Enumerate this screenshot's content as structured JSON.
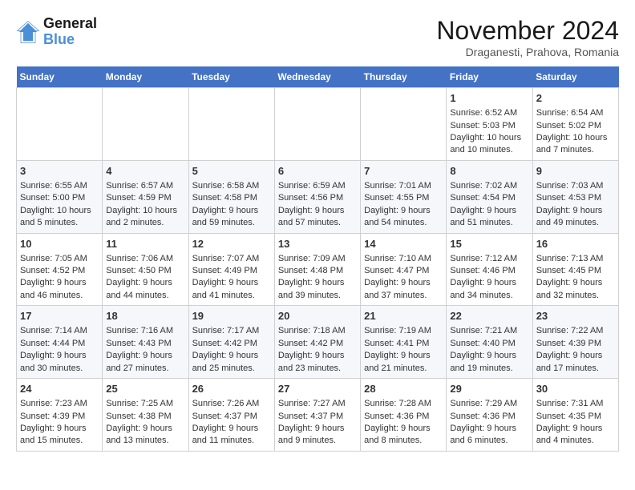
{
  "logo": {
    "line1": "General",
    "line2": "Blue"
  },
  "title": "November 2024",
  "subtitle": "Draganesti, Prahova, Romania",
  "headers": [
    "Sunday",
    "Monday",
    "Tuesday",
    "Wednesday",
    "Thursday",
    "Friday",
    "Saturday"
  ],
  "weeks": [
    [
      {
        "day": "",
        "lines": []
      },
      {
        "day": "",
        "lines": []
      },
      {
        "day": "",
        "lines": []
      },
      {
        "day": "",
        "lines": []
      },
      {
        "day": "",
        "lines": []
      },
      {
        "day": "1",
        "lines": [
          "Sunrise: 6:52 AM",
          "Sunset: 5:03 PM",
          "Daylight: 10 hours and 10 minutes."
        ]
      },
      {
        "day": "2",
        "lines": [
          "Sunrise: 6:54 AM",
          "Sunset: 5:02 PM",
          "Daylight: 10 hours and 7 minutes."
        ]
      }
    ],
    [
      {
        "day": "3",
        "lines": [
          "Sunrise: 6:55 AM",
          "Sunset: 5:00 PM",
          "Daylight: 10 hours and 5 minutes."
        ]
      },
      {
        "day": "4",
        "lines": [
          "Sunrise: 6:57 AM",
          "Sunset: 4:59 PM",
          "Daylight: 10 hours and 2 minutes."
        ]
      },
      {
        "day": "5",
        "lines": [
          "Sunrise: 6:58 AM",
          "Sunset: 4:58 PM",
          "Daylight: 9 hours and 59 minutes."
        ]
      },
      {
        "day": "6",
        "lines": [
          "Sunrise: 6:59 AM",
          "Sunset: 4:56 PM",
          "Daylight: 9 hours and 57 minutes."
        ]
      },
      {
        "day": "7",
        "lines": [
          "Sunrise: 7:01 AM",
          "Sunset: 4:55 PM",
          "Daylight: 9 hours and 54 minutes."
        ]
      },
      {
        "day": "8",
        "lines": [
          "Sunrise: 7:02 AM",
          "Sunset: 4:54 PM",
          "Daylight: 9 hours and 51 minutes."
        ]
      },
      {
        "day": "9",
        "lines": [
          "Sunrise: 7:03 AM",
          "Sunset: 4:53 PM",
          "Daylight: 9 hours and 49 minutes."
        ]
      }
    ],
    [
      {
        "day": "10",
        "lines": [
          "Sunrise: 7:05 AM",
          "Sunset: 4:52 PM",
          "Daylight: 9 hours and 46 minutes."
        ]
      },
      {
        "day": "11",
        "lines": [
          "Sunrise: 7:06 AM",
          "Sunset: 4:50 PM",
          "Daylight: 9 hours and 44 minutes."
        ]
      },
      {
        "day": "12",
        "lines": [
          "Sunrise: 7:07 AM",
          "Sunset: 4:49 PM",
          "Daylight: 9 hours and 41 minutes."
        ]
      },
      {
        "day": "13",
        "lines": [
          "Sunrise: 7:09 AM",
          "Sunset: 4:48 PM",
          "Daylight: 9 hours and 39 minutes."
        ]
      },
      {
        "day": "14",
        "lines": [
          "Sunrise: 7:10 AM",
          "Sunset: 4:47 PM",
          "Daylight: 9 hours and 37 minutes."
        ]
      },
      {
        "day": "15",
        "lines": [
          "Sunrise: 7:12 AM",
          "Sunset: 4:46 PM",
          "Daylight: 9 hours and 34 minutes."
        ]
      },
      {
        "day": "16",
        "lines": [
          "Sunrise: 7:13 AM",
          "Sunset: 4:45 PM",
          "Daylight: 9 hours and 32 minutes."
        ]
      }
    ],
    [
      {
        "day": "17",
        "lines": [
          "Sunrise: 7:14 AM",
          "Sunset: 4:44 PM",
          "Daylight: 9 hours and 30 minutes."
        ]
      },
      {
        "day": "18",
        "lines": [
          "Sunrise: 7:16 AM",
          "Sunset: 4:43 PM",
          "Daylight: 9 hours and 27 minutes."
        ]
      },
      {
        "day": "19",
        "lines": [
          "Sunrise: 7:17 AM",
          "Sunset: 4:42 PM",
          "Daylight: 9 hours and 25 minutes."
        ]
      },
      {
        "day": "20",
        "lines": [
          "Sunrise: 7:18 AM",
          "Sunset: 4:42 PM",
          "Daylight: 9 hours and 23 minutes."
        ]
      },
      {
        "day": "21",
        "lines": [
          "Sunrise: 7:19 AM",
          "Sunset: 4:41 PM",
          "Daylight: 9 hours and 21 minutes."
        ]
      },
      {
        "day": "22",
        "lines": [
          "Sunrise: 7:21 AM",
          "Sunset: 4:40 PM",
          "Daylight: 9 hours and 19 minutes."
        ]
      },
      {
        "day": "23",
        "lines": [
          "Sunrise: 7:22 AM",
          "Sunset: 4:39 PM",
          "Daylight: 9 hours and 17 minutes."
        ]
      }
    ],
    [
      {
        "day": "24",
        "lines": [
          "Sunrise: 7:23 AM",
          "Sunset: 4:39 PM",
          "Daylight: 9 hours and 15 minutes."
        ]
      },
      {
        "day": "25",
        "lines": [
          "Sunrise: 7:25 AM",
          "Sunset: 4:38 PM",
          "Daylight: 9 hours and 13 minutes."
        ]
      },
      {
        "day": "26",
        "lines": [
          "Sunrise: 7:26 AM",
          "Sunset: 4:37 PM",
          "Daylight: 9 hours and 11 minutes."
        ]
      },
      {
        "day": "27",
        "lines": [
          "Sunrise: 7:27 AM",
          "Sunset: 4:37 PM",
          "Daylight: 9 hours and 9 minutes."
        ]
      },
      {
        "day": "28",
        "lines": [
          "Sunrise: 7:28 AM",
          "Sunset: 4:36 PM",
          "Daylight: 9 hours and 8 minutes."
        ]
      },
      {
        "day": "29",
        "lines": [
          "Sunrise: 7:29 AM",
          "Sunset: 4:36 PM",
          "Daylight: 9 hours and 6 minutes."
        ]
      },
      {
        "day": "30",
        "lines": [
          "Sunrise: 7:31 AM",
          "Sunset: 4:35 PM",
          "Daylight: 9 hours and 4 minutes."
        ]
      }
    ]
  ]
}
